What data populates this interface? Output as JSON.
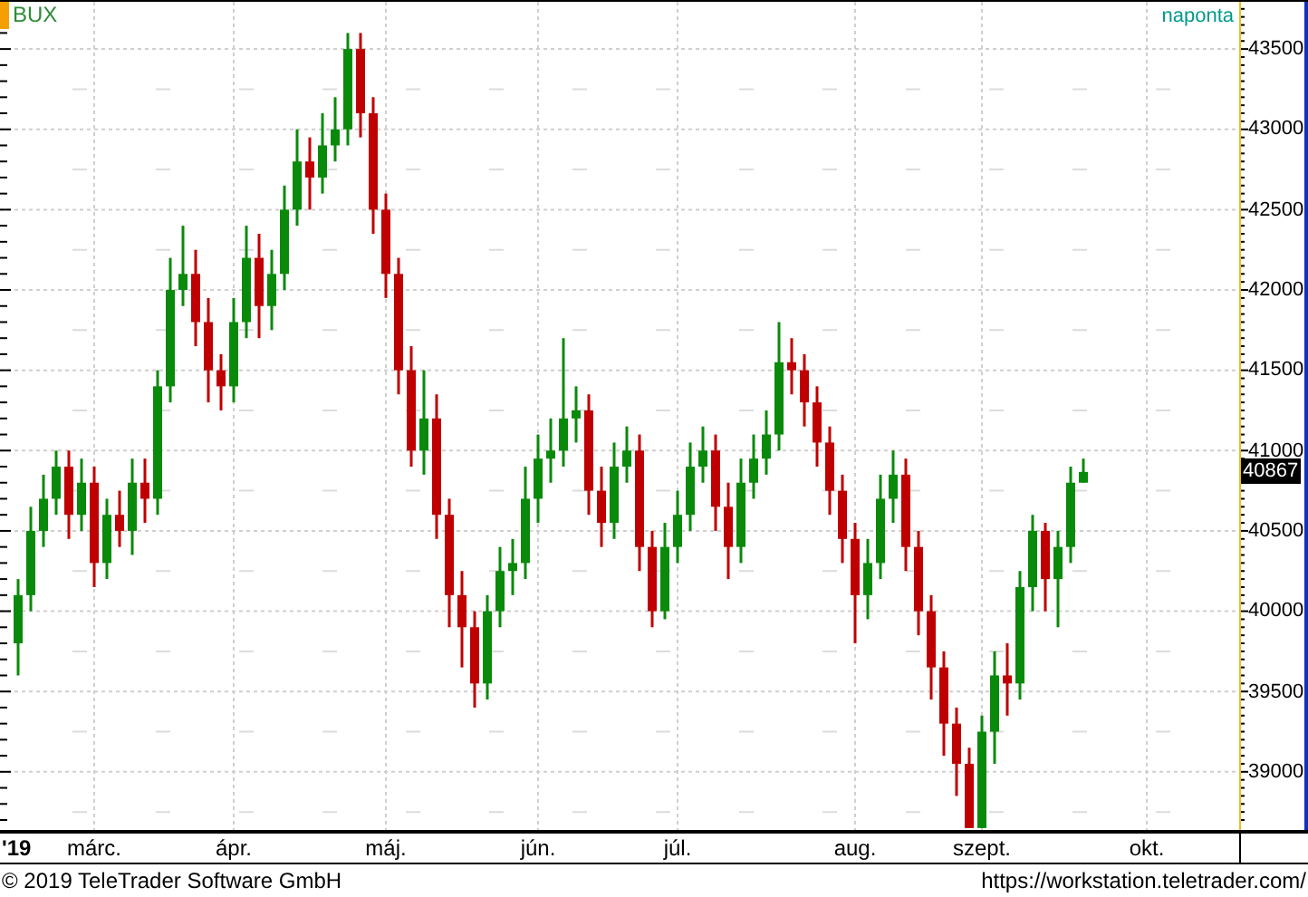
{
  "header": {
    "symbol": "BUX",
    "interval": "naponta"
  },
  "chart_data": {
    "type": "candlestick",
    "grid": true,
    "ylim": [
      38638,
      43794
    ],
    "yticks": [
      39000,
      39500,
      40000,
      40500,
      41000,
      41500,
      42000,
      42500,
      43000,
      43500
    ],
    "categories": [
      null,
      null,
      null,
      null,
      null,
      null,
      "márc.",
      null,
      null,
      null,
      null,
      null,
      null,
      null,
      null,
      null,
      null,
      "ápr.",
      null,
      null,
      null,
      null,
      null,
      null,
      null,
      null,
      null,
      null,
      null,
      "máj.",
      null,
      null,
      null,
      null,
      null,
      null,
      null,
      null,
      null,
      null,
      null,
      "jún.",
      null,
      null,
      null,
      null,
      null,
      null,
      null,
      null,
      null,
      null,
      "júl.",
      null,
      null,
      null,
      null,
      null,
      null,
      null,
      null,
      null,
      null,
      null,
      null,
      null,
      "aug.",
      null,
      null,
      null,
      null,
      null,
      null,
      null,
      null,
      null,
      "szept.",
      null,
      null,
      null,
      null,
      null,
      null,
      null,
      null,
      null,
      null,
      null,
      null,
      "okt."
    ],
    "ohlc": [
      [
        39800,
        40200,
        39600,
        40100
      ],
      [
        40100,
        40650,
        40000,
        40500
      ],
      [
        40500,
        40850,
        40400,
        40700
      ],
      [
        40700,
        41000,
        40600,
        40900
      ],
      [
        40900,
        41000,
        40450,
        40600
      ],
      [
        40600,
        40950,
        40500,
        40800
      ],
      [
        40800,
        40900,
        40150,
        40300
      ],
      [
        40300,
        40700,
        40200,
        40600
      ],
      [
        40600,
        40750,
        40400,
        40500
      ],
      [
        40500,
        40950,
        40350,
        40800
      ],
      [
        40800,
        40950,
        40550,
        40700
      ],
      [
        40700,
        41500,
        40600,
        41400
      ],
      [
        41400,
        42200,
        41300,
        42000
      ],
      [
        42000,
        42400,
        41900,
        42100
      ],
      [
        42100,
        42250,
        41650,
        41800
      ],
      [
        41800,
        41950,
        41300,
        41500
      ],
      [
        41500,
        41600,
        41250,
        41400
      ],
      [
        41400,
        41950,
        41300,
        41800
      ],
      [
        41800,
        42400,
        41700,
        42200
      ],
      [
        42200,
        42350,
        41700,
        41900
      ],
      [
        41900,
        42250,
        41750,
        42100
      ],
      [
        42100,
        42650,
        42000,
        42500
      ],
      [
        42500,
        43000,
        42400,
        42800
      ],
      [
        42800,
        42950,
        42500,
        42700
      ],
      [
        42700,
        43100,
        42600,
        42900
      ],
      [
        42900,
        43200,
        42800,
        43000
      ],
      [
        43000,
        43600,
        42900,
        43500
      ],
      [
        43500,
        43600,
        42950,
        43100
      ],
      [
        43100,
        43200,
        42350,
        42500
      ],
      [
        42500,
        42600,
        41950,
        42100
      ],
      [
        42100,
        42200,
        41350,
        41500
      ],
      [
        41500,
        41650,
        40900,
        41000
      ],
      [
        41000,
        41500,
        40850,
        41200
      ],
      [
        41200,
        41350,
        40450,
        40600
      ],
      [
        40600,
        40700,
        39900,
        40100
      ],
      [
        40100,
        40250,
        39650,
        39900
      ],
      [
        39900,
        40000,
        39400,
        39550
      ],
      [
        39550,
        40100,
        39450,
        40000
      ],
      [
        40000,
        40400,
        39900,
        40250
      ],
      [
        40250,
        40450,
        40100,
        40300
      ],
      [
        40300,
        40900,
        40200,
        40700
      ],
      [
        40700,
        41100,
        40550,
        40950
      ],
      [
        40950,
        41200,
        40800,
        41000
      ],
      [
        41000,
        41700,
        40900,
        41200
      ],
      [
        41200,
        41400,
        41050,
        41250
      ],
      [
        41250,
        41350,
        40600,
        40750
      ],
      [
        40750,
        40900,
        40400,
        40550
      ],
      [
        40550,
        41050,
        40450,
        40900
      ],
      [
        40900,
        41150,
        40800,
        41000
      ],
      [
        41000,
        41100,
        40250,
        40400
      ],
      [
        40400,
        40500,
        39900,
        40000
      ],
      [
        40000,
        40550,
        39950,
        40400
      ],
      [
        40400,
        40750,
        40300,
        40600
      ],
      [
        40600,
        41050,
        40500,
        40900
      ],
      [
        40900,
        41150,
        40800,
        41000
      ],
      [
        41000,
        41100,
        40500,
        40650
      ],
      [
        40650,
        40800,
        40200,
        40400
      ],
      [
        40400,
        40950,
        40300,
        40800
      ],
      [
        40800,
        41100,
        40700,
        40950
      ],
      [
        40950,
        41250,
        40850,
        41100
      ],
      [
        41100,
        41800,
        41000,
        41550
      ],
      [
        41550,
        41700,
        41350,
        41500
      ],
      [
        41500,
        41600,
        41150,
        41300
      ],
      [
        41300,
        41400,
        40900,
        41050
      ],
      [
        41050,
        41150,
        40600,
        40750
      ],
      [
        40750,
        40850,
        40300,
        40450
      ],
      [
        40450,
        40550,
        39800,
        40100
      ],
      [
        40100,
        40450,
        39950,
        40300
      ],
      [
        40300,
        40850,
        40200,
        40700
      ],
      [
        40700,
        41000,
        40550,
        40850
      ],
      [
        40850,
        40950,
        40250,
        40400
      ],
      [
        40400,
        40500,
        39850,
        40000
      ],
      [
        40000,
        40100,
        39450,
        39650
      ],
      [
        39650,
        39750,
        39100,
        39300
      ],
      [
        39300,
        39400,
        38850,
        39050
      ],
      [
        39050,
        39150,
        38650,
        38650
      ],
      [
        38650,
        39350,
        38650,
        39250
      ],
      [
        39250,
        39750,
        39050,
        39600
      ],
      [
        39600,
        39800,
        39350,
        39550
      ],
      [
        39550,
        40250,
        39450,
        40150
      ],
      [
        40150,
        40600,
        40000,
        40500
      ],
      [
        40500,
        40550,
        40000,
        40200
      ],
      [
        40200,
        40500,
        39900,
        40400
      ],
      [
        40400,
        40900,
        40300,
        40800
      ],
      [
        40800,
        40950,
        40800,
        40867
      ],
      null,
      null,
      null,
      null,
      null
    ]
  },
  "year_label": "'19",
  "last_price": "40867",
  "footer": {
    "copyright": "© 2019 TeleTrader Software GmbH",
    "url": "https://workstation.teletrader.com/"
  }
}
